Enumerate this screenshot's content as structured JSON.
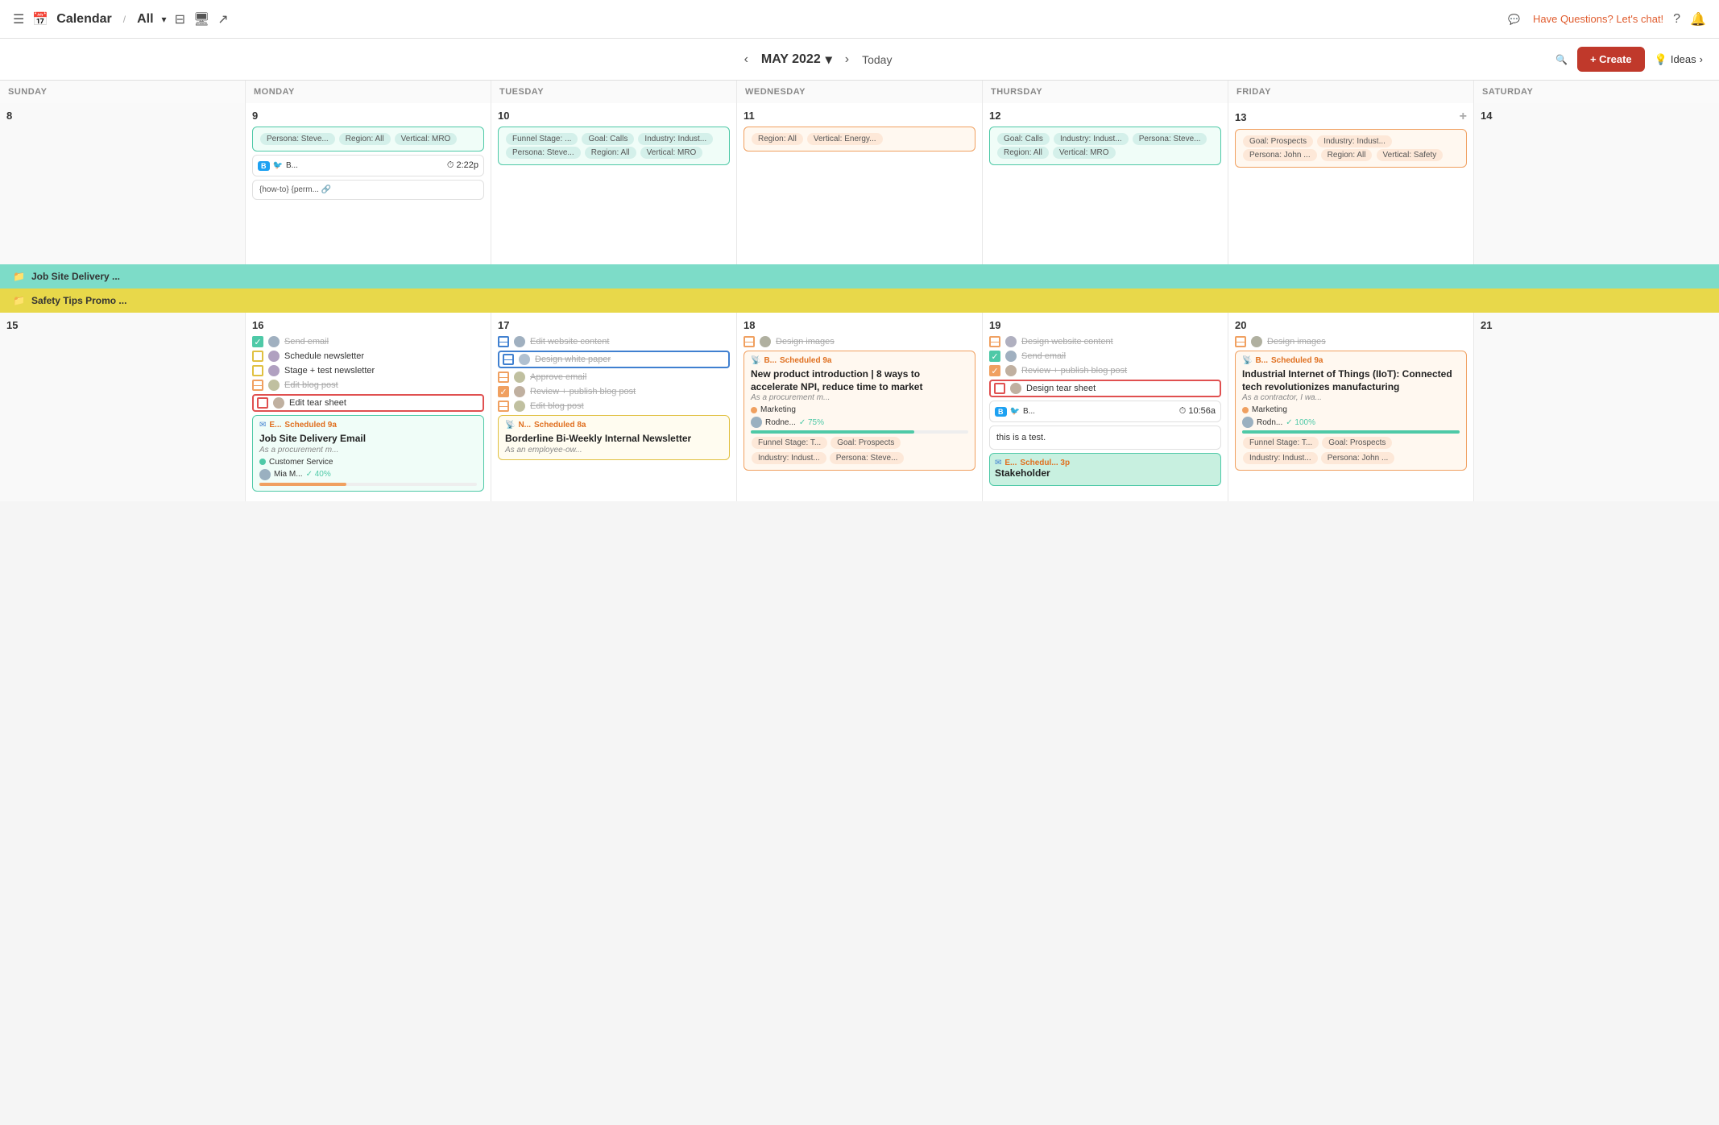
{
  "topNav": {
    "menuIcon": "☰",
    "calendarIcon": "📅",
    "title": "Calendar",
    "separator": "/",
    "allLabel": "All",
    "filterIcon": "⊟",
    "desktopIcon": "🖥",
    "shareIcon": "↗",
    "chatText": "Have Questions? Let's chat!",
    "helpIcon": "?",
    "bellIcon": "🔔"
  },
  "calHeader": {
    "prevIcon": "‹",
    "nextIcon": "›",
    "monthLabel": "MAY 2022",
    "dropIcon": "▾",
    "todayLabel": "Today",
    "searchIcon": "🔍",
    "createLabel": "+ Create",
    "ideasLabel": "Ideas",
    "ideasIcon": "💡",
    "chevronRight": "›"
  },
  "dayHeaders": [
    "SUNDAY",
    "MONDAY",
    "TUESDAY",
    "WEDNESDAY",
    "THURSDAY",
    "FRIDAY",
    "SATURDAY"
  ],
  "week1": {
    "days": [
      {
        "num": "8",
        "items": []
      },
      {
        "num": "9",
        "items": [
          {
            "type": "tags",
            "tags": [
              "Persona: Steve...",
              "Region: All",
              "Vertical: MRO"
            ],
            "cardStyle": "teal-border"
          },
          {
            "type": "post-card",
            "logo": "B",
            "twitterIcon": true,
            "time": "2:22p",
            "permalink": "{how-to} {perm..."
          }
        ]
      },
      {
        "num": "10",
        "items": [
          {
            "type": "tags",
            "tags": [
              "Funnel Stage: ...",
              "Goal: Calls",
              "Industry: Indust...",
              "Persona: Steve...",
              "Region: All",
              "Vertical: MRO"
            ],
            "cardStyle": "teal-border"
          }
        ]
      },
      {
        "num": "11",
        "items": [
          {
            "type": "tags-orange",
            "tags": [
              "Region: All",
              "Vertical: Energy..."
            ],
            "cardStyle": "orange-border"
          }
        ]
      },
      {
        "num": "12",
        "items": [
          {
            "type": "tags",
            "tags": [
              "Goal: Calls",
              "Industry: Indust...",
              "Persona: Steve...",
              "Region: All",
              "Vertical: MRO"
            ],
            "cardStyle": "teal-border"
          }
        ]
      },
      {
        "num": "13",
        "addIcon": true,
        "items": [
          {
            "type": "tags-orange",
            "tags": [
              "Goal: Prospects",
              "Industry: Indust...",
              "Persona: John ...",
              "Region: All",
              "Vertical: Safety"
            ],
            "cardStyle": "orange-border"
          }
        ]
      },
      {
        "num": "14",
        "items": []
      }
    ]
  },
  "banners": {
    "jobSite": "Job Site Delivery ...",
    "safetyTips": "Safety Tips Promo ..."
  },
  "week2": {
    "days": [
      {
        "num": "15",
        "items": []
      },
      {
        "num": "16",
        "items": [
          {
            "type": "checkbox-item",
            "checked": true,
            "checkedStyle": "checked",
            "strikethrough": true,
            "label": "Send email",
            "hasAvatar": true
          },
          {
            "type": "checkbox-item",
            "checked": false,
            "checkedStyle": "empty-yellow",
            "strikethrough": false,
            "label": "Schedule newsletter",
            "hasAvatar": true
          },
          {
            "type": "checkbox-item",
            "checked": false,
            "checkedStyle": "empty-yellow",
            "strikethrough": false,
            "label": "Stage + test newsletter",
            "hasAvatar": true
          },
          {
            "type": "checkbox-item",
            "checked": false,
            "checkedStyle": "dash-orange",
            "strikethrough": true,
            "label": "Edit blog post",
            "hasAvatar": true
          },
          {
            "type": "checkbox-item",
            "checked": false,
            "checkedStyle": "empty-red",
            "strikethrough": false,
            "label": "Edit tear sheet",
            "hasAvatar": true,
            "redBorder": true
          },
          {
            "type": "scheduled-card",
            "icon": "email",
            "scheduledTime": "9a",
            "title": "Job Site Delivery Email",
            "subtitle": "As a procurement m...",
            "dot": "teal",
            "dotLabel": "Customer Service",
            "person": "Mia M...",
            "progress": 40,
            "progressColor": "fill-orange",
            "cardStyle": "teal-border"
          }
        ]
      },
      {
        "num": "17",
        "items": [
          {
            "type": "checkbox-item",
            "checked": false,
            "checkedStyle": "dash-blue",
            "strikethrough": true,
            "label": "Edit website content",
            "hasAvatar": true
          },
          {
            "type": "checkbox-item",
            "checked": false,
            "checkedStyle": "dash-blue",
            "strikethrough": true,
            "label": "Design white paper",
            "hasAvatar": true,
            "blueBorder": true
          },
          {
            "type": "checkbox-item",
            "checked": false,
            "checkedStyle": "dash-orange",
            "strikethrough": true,
            "label": "Approve email",
            "hasAvatar": true
          },
          {
            "type": "checkbox-item",
            "checked": true,
            "checkedStyle": "checked-orange",
            "strikethrough": true,
            "label": "Review + publish blog post",
            "hasAvatar": true
          },
          {
            "type": "checkbox-item",
            "checked": false,
            "checkedStyle": "dash-orange",
            "strikethrough": true,
            "label": "Edit blog post",
            "hasAvatar": true
          },
          {
            "type": "scheduled-card",
            "icon": "rss",
            "scheduledTime": "8a",
            "title": "Borderline Bi-Weekly Internal Newsletter",
            "subtitle": "As an employee-ow...",
            "cardStyle": "yellow-border",
            "scheduledLabel": "N..."
          }
        ]
      },
      {
        "num": "18",
        "items": [
          {
            "type": "checkbox-item",
            "checked": false,
            "checkedStyle": "dash-orange",
            "strikethrough": true,
            "label": "Design images",
            "hasAvatar": true
          },
          {
            "type": "blog-card",
            "icon": "rss",
            "scheduledLabel": "B...",
            "scheduledTime": "9a",
            "title": "New product introduction | 8 ways to accelerate NPI, reduce time to market",
            "subtitle": "As a procurement m...",
            "dot": "orange",
            "dotLabel": "Marketing",
            "person": "Rodne...",
            "progress": 75,
            "progressColor": "fill-green",
            "tags": [
              "Funnel Stage: T...",
              "Goal: Prospects",
              "Industry: Indust...",
              "Persona: Steve..."
            ],
            "cardStyle": "orange-border"
          }
        ]
      },
      {
        "num": "19",
        "items": [
          {
            "type": "checkbox-item",
            "checked": false,
            "checkedStyle": "dash-orange",
            "strikethrough": true,
            "label": "Design website content",
            "hasAvatar": true
          },
          {
            "type": "checkbox-item",
            "checked": true,
            "checkedStyle": "checked",
            "strikethrough": true,
            "label": "Send email",
            "hasAvatar": true
          },
          {
            "type": "checkbox-item",
            "checked": true,
            "checkedStyle": "checked-orange",
            "strikethrough": true,
            "label": "Review + publish blog post",
            "hasAvatar": true
          },
          {
            "type": "checkbox-item",
            "checked": false,
            "checkedStyle": "empty-red",
            "strikethrough": false,
            "label": "Design tear sheet",
            "hasAvatar": true,
            "redBorder": true
          },
          {
            "type": "post-card2",
            "logo": "B",
            "twitterIcon": true,
            "time": "10:56a"
          },
          {
            "type": "test-card",
            "text": "this is a test."
          },
          {
            "type": "scheduled-mini",
            "scheduledTime": "3p",
            "scheduledLabel": "E...",
            "title": "Stakeholder"
          }
        ]
      },
      {
        "num": "20",
        "items": [
          {
            "type": "checkbox-item",
            "checked": false,
            "checkedStyle": "dash-orange",
            "strikethrough": true,
            "label": "Design images",
            "hasAvatar": true
          },
          {
            "type": "scheduled-card",
            "icon": "rss",
            "scheduledTime": "9a",
            "title": "Industrial Internet of Things (IIoT): Connected tech revolutionizes manufacturing",
            "subtitle": "As a contractor, I wa...",
            "dot": "orange",
            "dotLabel": "Marketing",
            "person": "Rodn...",
            "progress": 100,
            "progressColor": "fill-green",
            "tags": [
              "Funnel Stage: T...",
              "Goal: Prospects",
              "Industry: Indust...",
              "Persona: John ..."
            ],
            "cardStyle": "orange-border",
            "scheduledLabel": "B..."
          }
        ]
      },
      {
        "num": "21",
        "items": []
      }
    ]
  }
}
